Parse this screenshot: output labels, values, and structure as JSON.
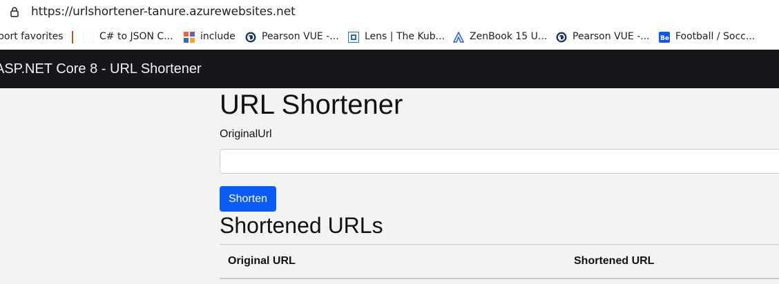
{
  "browser": {
    "url": "https://urlshortener-tanure.azurewebsites.net",
    "bookmarks": [
      {
        "label": "port favorites",
        "icon": "none"
      },
      {
        "label": "C# to JSON C...",
        "icon": "blank-page-icon"
      },
      {
        "label": "include",
        "icon": "grid-icon"
      },
      {
        "label": "Pearson VUE -...",
        "icon": "pearson-icon"
      },
      {
        "label": "Lens | The Kub...",
        "icon": "lens-icon"
      },
      {
        "label": "ZenBook 15 U...",
        "icon": "zenbook-icon"
      },
      {
        "label": "Pearson VUE -...",
        "icon": "pearson-icon"
      },
      {
        "label": "Football / Socc...",
        "icon": "behance-icon"
      }
    ]
  },
  "navbar": {
    "brand": "ASP.NET Core 8 - URL Shortener"
  },
  "main": {
    "title": "URL Shortener",
    "field_label": "OriginalUrl",
    "input_value": "",
    "shorten_label": "Shorten",
    "section_title": "Shortened URLs",
    "table": {
      "headers": [
        "Original URL",
        "Shortened URL"
      ]
    }
  },
  "colors": {
    "navbar_bg": "#16171a",
    "primary_button": "#0b5cf7",
    "page_bg": "#f3f3f3"
  }
}
